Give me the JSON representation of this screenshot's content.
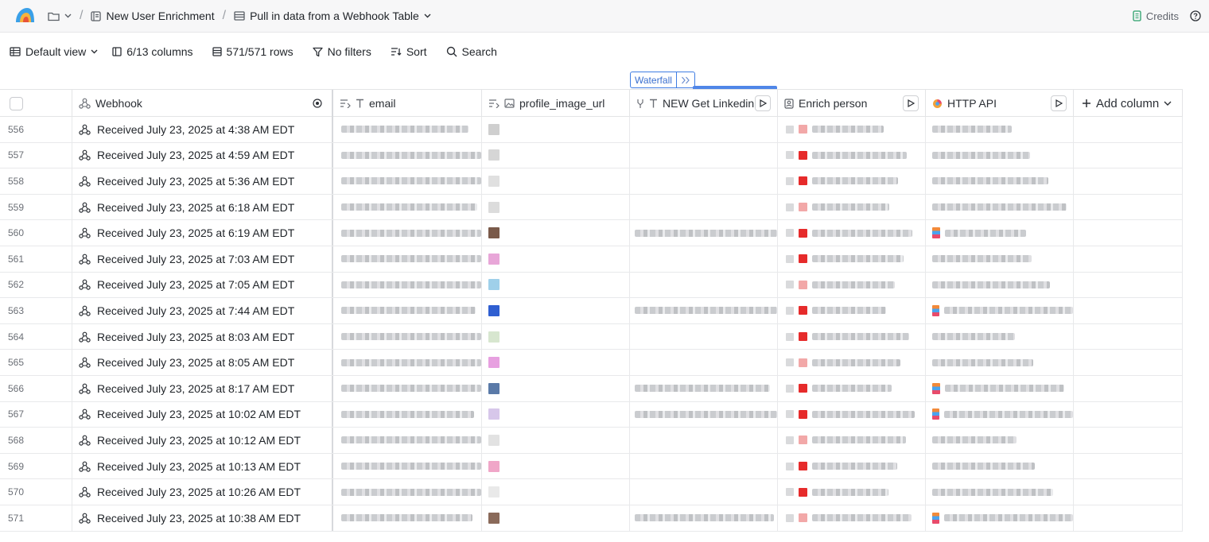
{
  "breadcrumb": {
    "workspace_label": "New User Enrichment",
    "table_label": "Pull in data from a Webhook Table"
  },
  "top_right": {
    "credits_label": "Credits"
  },
  "toolbar": {
    "view_label": "Default view",
    "columns_label": "6/13 columns",
    "rows_label": "571/571 rows",
    "filters_label": "No filters",
    "sort_label": "Sort",
    "search_label": "Search"
  },
  "waterfall_label": "Waterfall",
  "columns": {
    "webhook": "Webhook",
    "email": "email",
    "profile_image_url": "profile_image_url",
    "linkedin": "NEW Get Linkedin",
    "enrich": "Enrich person",
    "http": "HTTP API",
    "add": "Add column"
  },
  "rows": [
    {
      "num": "556",
      "webhook": "Received July 23, 2025 at 4:38 AM EDT"
    },
    {
      "num": "557",
      "webhook": "Received July 23, 2025 at 4:59 AM EDT"
    },
    {
      "num": "558",
      "webhook": "Received July 23, 2025 at 5:36 AM EDT"
    },
    {
      "num": "559",
      "webhook": "Received July 23, 2025 at 6:18 AM EDT"
    },
    {
      "num": "560",
      "webhook": "Received July 23, 2025 at 6:19 AM EDT"
    },
    {
      "num": "561",
      "webhook": "Received July 23, 2025 at 7:03 AM EDT"
    },
    {
      "num": "562",
      "webhook": "Received July 23, 2025 at 7:05 AM EDT"
    },
    {
      "num": "563",
      "webhook": "Received July 23, 2025 at 7:44 AM EDT"
    },
    {
      "num": "564",
      "webhook": "Received July 23, 2025 at 8:03 AM EDT"
    },
    {
      "num": "565",
      "webhook": "Received July 23, 2025 at 8:05 AM EDT"
    },
    {
      "num": "566",
      "webhook": "Received July 23, 2025 at 8:17 AM EDT"
    },
    {
      "num": "567",
      "webhook": "Received July 23, 2025 at 10:02 AM EDT"
    },
    {
      "num": "568",
      "webhook": "Received July 23, 2025 at 10:12 AM EDT"
    },
    {
      "num": "569",
      "webhook": "Received July 23, 2025 at 10:13 AM EDT"
    },
    {
      "num": "570",
      "webhook": "Received July 23, 2025 at 10:26 AM EDT"
    },
    {
      "num": "571",
      "webhook": "Received July 23, 2025 at 10:38 AM EDT"
    }
  ]
}
